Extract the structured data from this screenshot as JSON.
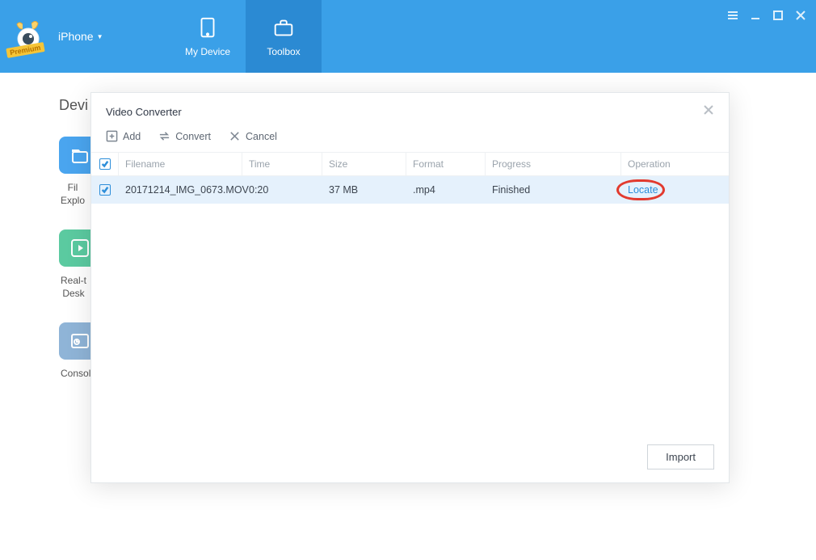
{
  "header": {
    "device_label": "iPhone",
    "premium_badge": "Premium",
    "tabs": {
      "my_device": "My Device",
      "toolbox": "Toolbox"
    }
  },
  "background_page": {
    "title_partial": "Devi",
    "items": [
      {
        "label_line1": "Fil",
        "label_line2": "Explo",
        "color": "#4aa5ef",
        "icon": "folder"
      },
      {
        "label_line1": "Real-t",
        "label_line2": "Desk",
        "color": "#5bcaa0",
        "icon": "play"
      },
      {
        "label_line1": "Consol",
        "label_line2": "",
        "color": "#8fb4d7",
        "icon": "console"
      }
    ]
  },
  "modal": {
    "title": "Video Converter",
    "toolbar": {
      "add": "Add",
      "convert": "Convert",
      "cancel": "Cancel"
    },
    "columns": {
      "filename": "Filename",
      "time": "Time",
      "size": "Size",
      "format": "Format",
      "progress": "Progress",
      "operation": "Operation"
    },
    "rows": [
      {
        "checked": true,
        "filename": "20171214_IMG_0673.MOV",
        "time": "0:20",
        "size": "37 MB",
        "format": ".mp4",
        "progress": "Finished",
        "operation": "Locate"
      }
    ],
    "footer": {
      "import": "Import"
    }
  }
}
